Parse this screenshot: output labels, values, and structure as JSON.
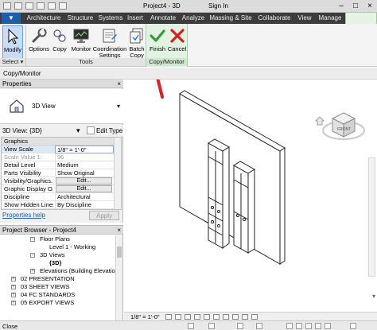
{
  "title_bar": {
    "title": "Project4 - 3D",
    "sign_in": "Sign In"
  },
  "ribbon_tabs": [
    "Architecture",
    "Structure",
    "Systems",
    "Insert",
    "Annotate",
    "Analyze",
    "Massing & Site",
    "Collaborate",
    "View",
    "Manage"
  ],
  "ribbon": {
    "modify_label": "Modify",
    "tools": [
      {
        "line1": "Options",
        "line2": ""
      },
      {
        "line1": "Copy",
        "line2": ""
      },
      {
        "line1": "Monitor",
        "line2": ""
      },
      {
        "line1": "Coordination",
        "line2": "Settings"
      },
      {
        "line1": "Batch",
        "line2": "Copy"
      }
    ],
    "finish_label": "Finish",
    "cancel_label": "Cancel",
    "panel_select": "Select ▾",
    "panel_tools": "Tools",
    "panel_copy_monitor": "Copy/Monitor"
  },
  "options_bar": {
    "label": "Copy/Monitor"
  },
  "properties": {
    "header": "Properties",
    "type_name": "3D View",
    "selector_value": "3D View: {3D}",
    "edit_type": "Edit Type",
    "section": "Graphics",
    "rows": [
      {
        "key": "View Scale",
        "value": "1/8\" = 1'-0\""
      },
      {
        "key": "Scale Value    1:",
        "value": "96"
      },
      {
        "key": "Detail Level",
        "value": "Medium"
      },
      {
        "key": "Parts Visibility",
        "value": "Show Original"
      },
      {
        "key": "Visibility/Graphics...",
        "value": "Edit..."
      },
      {
        "key": "Graphic Display O...",
        "value": "Edit..."
      },
      {
        "key": "Discipline",
        "value": "Architectural"
      },
      {
        "key": "Show Hidden Lines",
        "value": "By Discipline"
      }
    ],
    "help_link": "Properties help",
    "apply": "Apply"
  },
  "project_browser": {
    "header": "Project Browser - Project4",
    "items": [
      {
        "label": "Floor Plans",
        "toggle": "-"
      },
      {
        "label": "Level 1 - Working",
        "toggle": ""
      },
      {
        "label": "3D Views",
        "toggle": "-"
      },
      {
        "label": "{3D}",
        "toggle": ""
      },
      {
        "label": "Elevations (Building Elevation",
        "toggle": "+"
      },
      {
        "label": "02 PRESENTATION",
        "toggle": "+"
      },
      {
        "label": "03 SHEET VIEWS",
        "toggle": "+"
      },
      {
        "label": "04 FC STANDARDS",
        "toggle": "+"
      },
      {
        "label": "05 EXPORT VIEWS",
        "toggle": "+"
      }
    ]
  },
  "view_control": {
    "scale": "1/8\" = 1'-0\""
  },
  "status_bar": {
    "text": "Close"
  },
  "colors": {
    "file_tab": "#1f5ea8",
    "finish_check": "#3a9a3a",
    "cancel_x": "#d02020",
    "annotation_arrow": "#d8232a",
    "modify_highlight": "#c9dcf5"
  }
}
